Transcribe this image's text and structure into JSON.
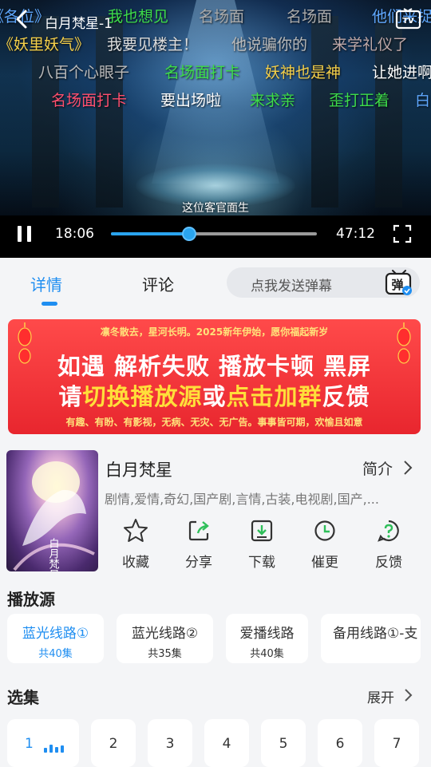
{
  "player": {
    "title": "白月梵星-1",
    "subtitle": "这位客官面生",
    "current_time": "18:06",
    "total_time": "47:12",
    "progress": 0.38,
    "danmaku": [
      {
        "text": "《各位》",
        "color": "#5fa8ff"
      },
      {
        "text": "我也想见",
        "color": "#3ddc4a"
      },
      {
        "text": "名场面",
        "color": "#aaaaaa"
      },
      {
        "text": "名场面",
        "color": "#aaaaaa"
      },
      {
        "text": "他们来捉我",
        "color": "#5fa8ff"
      },
      {
        "text": "《妖里妖气》",
        "color": "#f5d04a"
      },
      {
        "text": "我要见楼主！",
        "color": "#dddddd"
      },
      {
        "text": "他说骗你的",
        "color": "#bbbbbb"
      },
      {
        "text": "来学礼仪了",
        "color": "#bfa8a8"
      },
      {
        "text": "八百个心眼子",
        "color": "#bbbbbb"
      },
      {
        "text": "名场面打卡",
        "color": "#3ddc4a"
      },
      {
        "text": "妖神也是神",
        "color": "#f5d04a"
      },
      {
        "text": "让她进啊",
        "color": "#ffffff"
      },
      {
        "text": "名场面打卡",
        "color": "#ff4f6e"
      },
      {
        "text": "要出场啦",
        "color": "#ffffff"
      },
      {
        "text": "来求亲",
        "color": "#3ddc4a"
      },
      {
        "text": "歪打正着",
        "color": "#3ddc4a"
      },
      {
        "text": "白",
        "color": "#5fa8ff"
      }
    ]
  },
  "tabs": {
    "details": "详情",
    "comments": "评论",
    "danmaku_placeholder": "点我发送弹幕",
    "danmaku_icon_text": "弹"
  },
  "banner": {
    "top_line": "凛冬散去，星河长明。2025新年伊始，愿你福起新岁",
    "line1": "如遇 解析失败 播放卡顿 黑屏",
    "line2_a": "请",
    "line2_b": "切换播放源",
    "line2_c": "或",
    "line2_d": "点击加群",
    "line2_e": "反馈",
    "bottom_line": "有趣、有盼、有影视，无病、无灾、无广告。事事皆可期，欢愉且如意"
  },
  "show": {
    "title": "白月梵星",
    "intro_label": "简介",
    "genres": "剧情,爱情,奇幻,国产剧,言情,古装,电视剧,国产,...",
    "poster_text": "白月梵星",
    "actions": [
      {
        "label": "收藏",
        "icon": "star-icon"
      },
      {
        "label": "分享",
        "icon": "share-icon"
      },
      {
        "label": "下载",
        "icon": "download-icon"
      },
      {
        "label": "催更",
        "icon": "clock-icon"
      },
      {
        "label": "反馈",
        "icon": "feedback-icon"
      }
    ]
  },
  "sources": {
    "heading": "播放源",
    "items": [
      {
        "name": "蓝光线路①",
        "count": "共40集"
      },
      {
        "name": "蓝光线路②",
        "count": "共35集"
      },
      {
        "name": "爱播线路",
        "count": "共40集"
      },
      {
        "name": "备用线路①-支",
        "count": ""
      }
    ]
  },
  "episodes": {
    "heading": "选集",
    "expand_label": "展开",
    "items": [
      "1",
      "2",
      "3",
      "4",
      "5",
      "6",
      "7"
    ]
  },
  "colors": {
    "accent": "#1f8ef1",
    "banner_red": "#e8262e",
    "banner_yellow": "#ffdf3a"
  }
}
